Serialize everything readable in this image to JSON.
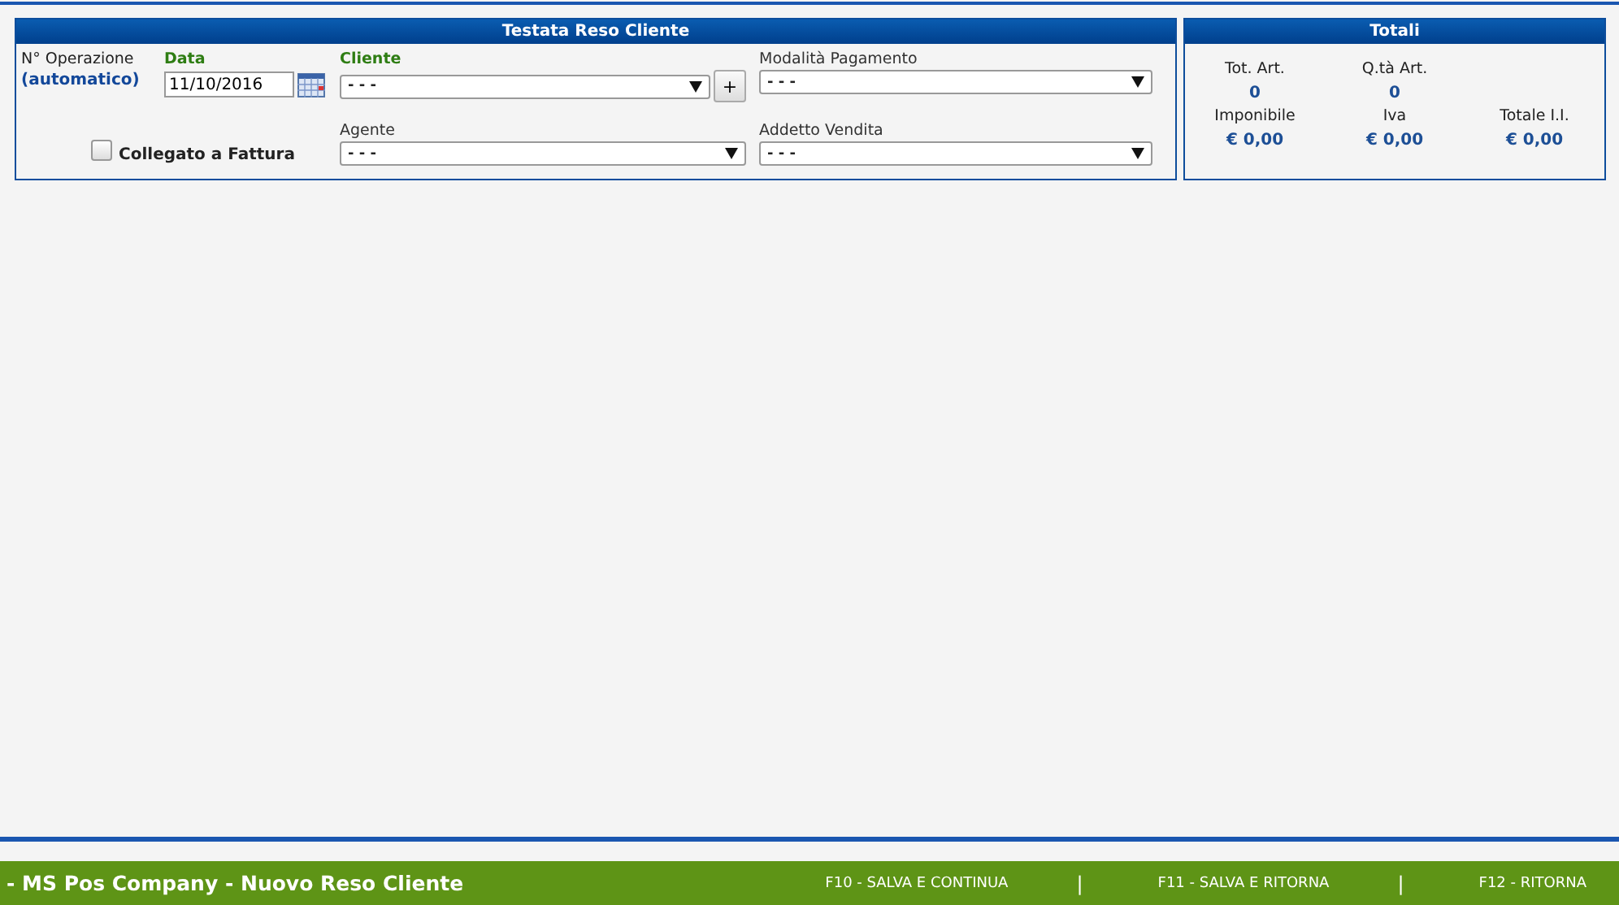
{
  "header_panel": {
    "title": "Testata Reso Cliente",
    "operation": {
      "label": "N° Operazione",
      "value": "(automatico)"
    },
    "date": {
      "label": "Data",
      "value": "11/10/2016",
      "required": true
    },
    "linked_invoice": {
      "label": "Collegato a Fattura",
      "checked": false
    },
    "selects": [
      {
        "label": "Cliente",
        "value": "- - -",
        "required": true,
        "add_button": "+"
      },
      {
        "label": "Modalità Pagamento",
        "value": "- - -",
        "required": false
      },
      {
        "label": "Agente",
        "value": "- - -",
        "required": false
      },
      {
        "label": "Addetto Vendita",
        "value": "- - -",
        "required": false
      }
    ]
  },
  "totals_panel": {
    "title": "Totali",
    "rows": [
      [
        {
          "label": "Tot. Art.",
          "value": "0"
        },
        {
          "label": "Q.tà Art.",
          "value": "0"
        }
      ],
      [
        {
          "label": "Imponibile",
          "value": "€ 0,00"
        },
        {
          "label": "Iva",
          "value": "€ 0,00"
        },
        {
          "label": "Totale I.I.",
          "value": "€ 0,00"
        }
      ]
    ]
  },
  "footer": {
    "title": "- MS Pos Company - Nuovo Reso Cliente",
    "actions": [
      {
        "kind": "action",
        "label": "F10 - SALVA E CONTINUA"
      },
      {
        "kind": "separator",
        "label": "|"
      },
      {
        "kind": "action",
        "label": "F11 - SALVA E RITORNA"
      },
      {
        "kind": "separator",
        "label": "|"
      },
      {
        "kind": "action",
        "label": "F12 - RITORNA"
      }
    ]
  }
}
